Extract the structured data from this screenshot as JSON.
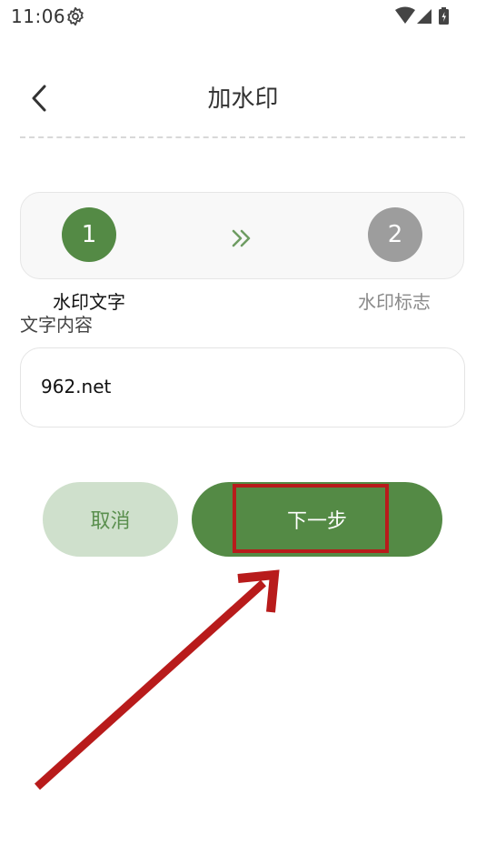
{
  "status_bar": {
    "time": "11:06"
  },
  "header": {
    "title": "加水印"
  },
  "stepper": {
    "steps": [
      {
        "number": "1",
        "label": "水印文字",
        "active": true
      },
      {
        "number": "2",
        "label": "水印标志",
        "active": false
      }
    ]
  },
  "form": {
    "content_label": "文字内容",
    "content_value": "962.net"
  },
  "actions": {
    "cancel_label": "取消",
    "next_label": "下一步"
  },
  "colors": {
    "primary": "#548a45",
    "cancel_bg": "#cfe0cc",
    "inactive_step": "#9d9d9d",
    "annotation": "#b81b1b"
  },
  "icons": [
    "gear-icon",
    "wifi-icon",
    "signal-icon",
    "battery-icon",
    "back-icon",
    "double-chevron-icon"
  ]
}
